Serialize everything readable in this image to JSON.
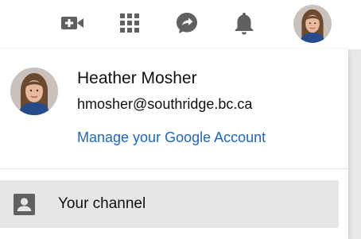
{
  "toolbar": {
    "icons": [
      "video-create-icon",
      "apps-grid-icon",
      "messages-icon",
      "notifications-bell-icon"
    ],
    "icon_color": "#606060"
  },
  "account_menu": {
    "name": "Heather Mosher",
    "email": "hmosher@southridge.bc.ca",
    "manage_link": "Manage your Google Account",
    "items": [
      {
        "label": "Your channel",
        "icon": "account-box-icon",
        "highlighted": true
      }
    ]
  },
  "colors": {
    "link": "#1a66cc",
    "hover_bg": "#e6e6e6",
    "icon": "#606060"
  }
}
